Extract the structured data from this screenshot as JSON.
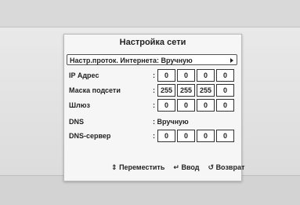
{
  "dialog": {
    "title": "Настройка сети",
    "protocol_label": "Настр.проток. Интернета: Вручную",
    "ip": {
      "label": "IP Адрес",
      "octets": [
        "0",
        "0",
        "0",
        "0"
      ]
    },
    "mask": {
      "label": "Маска подсети",
      "octets": [
        "255",
        "255",
        "255",
        "0"
      ]
    },
    "gateway": {
      "label": "Шлюз",
      "octets": [
        "0",
        "0",
        "0",
        "0"
      ]
    },
    "dns": {
      "label": "DNS",
      "value": ": Вручную"
    },
    "dns_server": {
      "label": "DNS-сервер",
      "octets": [
        "0",
        "0",
        "0",
        "0"
      ]
    },
    "colon": ":"
  },
  "footer": {
    "move_icon": "updown-arrows-icon",
    "move_label": "Переместить",
    "enter_icon": "enter-icon",
    "enter_label": "Ввод",
    "return_icon": "return-icon",
    "return_label": "Возврат"
  }
}
